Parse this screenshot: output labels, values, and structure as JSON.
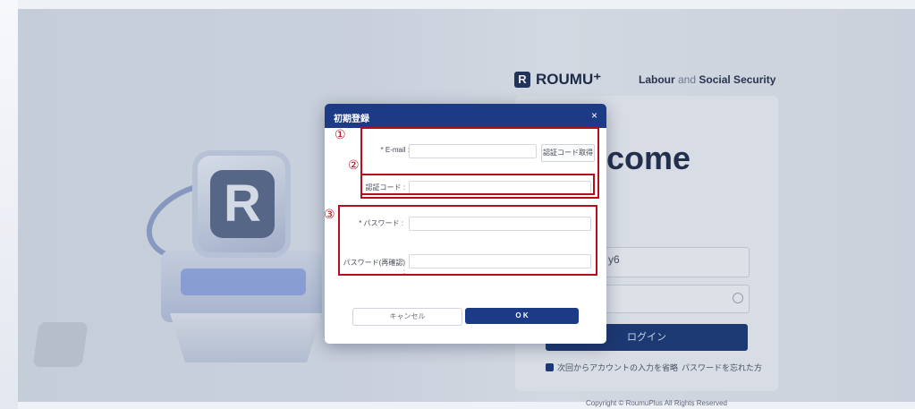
{
  "background": {
    "brand": {
      "icon": "roumu-logo-icon",
      "name": "ROUMU⁺"
    },
    "tagline": {
      "part1": "Labour",
      "part2": " and ",
      "part3": "Social Security"
    },
    "welcome_partial": "come",
    "username_partial": "y6",
    "login_button": "ログイン",
    "remember_label": "次回からアカウントの入力を省略",
    "forgot_link": "パスワードを忘れた方",
    "copyright": "Copyright © RoumuPlus All Rights Reserved"
  },
  "modal": {
    "title": "初期登録",
    "close_icon": "×",
    "email_label": "* E-mail :",
    "email_value": "",
    "get_code_button": "認証コード取得",
    "code_label": "認証コード :",
    "code_value": "",
    "password_label": "* パスワード :",
    "password_value": "",
    "password_confirm_label": "パスワード(再確認) :",
    "password_confirm_value": "",
    "cancel_button": "キャンセル",
    "ok_button": "O K"
  },
  "annotations": {
    "marker_1": "①",
    "marker_2": "②",
    "marker_3": "③",
    "color": "#b3101b"
  },
  "colors": {
    "primary": "#1c3a86"
  }
}
